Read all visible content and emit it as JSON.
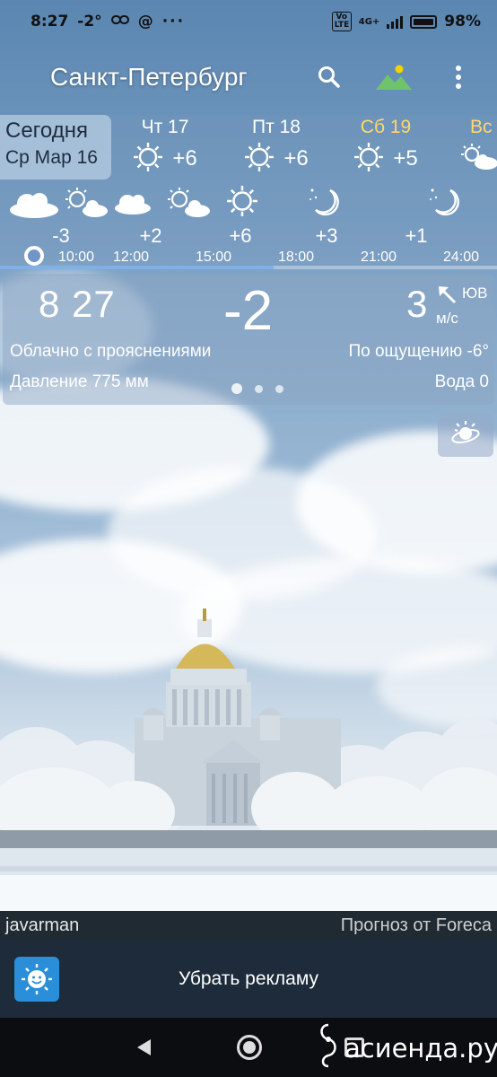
{
  "status_bar": {
    "time": "8:27",
    "temp": "-2°",
    "at_sign": "@",
    "more": "···",
    "volte": "Vo LTE",
    "network": "4G+",
    "battery": "98%"
  },
  "app_bar": {
    "city": "Санкт-Петербург",
    "icons": [
      "search-icon",
      "landscape-icon",
      "more-vert-icon"
    ]
  },
  "days": {
    "today_label": "Сегодня",
    "today_date": "Ср Мар 16",
    "items": [
      {
        "name": "Чт 17",
        "temp": "+6",
        "icon": "sun-icon",
        "color": "#ffffff"
      },
      {
        "name": "Пт 18",
        "temp": "+6",
        "icon": "sun-icon",
        "color": "#ffffff"
      },
      {
        "name": "Сб 19",
        "temp": "+5",
        "icon": "sun-icon",
        "color": "#ffd76a"
      },
      {
        "name": "Вс",
        "temp": "",
        "icon": "sun-cloud-icon",
        "color": "#ffd76a"
      }
    ]
  },
  "hours": {
    "times": [
      "10:00",
      "12:00",
      "15:00",
      "18:00",
      "21:00",
      "24:00"
    ],
    "temps": [
      "-3",
      "+2",
      "+6",
      "+3",
      "+1"
    ],
    "icons": [
      "cloud-icon",
      "sun-cloud-icon",
      "cloud-icon",
      "sun-cloud-icon",
      "sun-icon",
      "moon-icon",
      "moon-icon"
    ],
    "progress_fraction": 0.55
  },
  "current": {
    "time": "8 27",
    "temp": "-2",
    "wind_speed": "3",
    "wind_dir": "ЮВ",
    "wind_unit": "м/с",
    "description": "Облачно с прояснениями",
    "feels_like": "По ощущению -6°",
    "pressure": "Давление 775 мм",
    "water": "Вода 0",
    "page_dots": 3,
    "active_dot": 0
  },
  "credits": {
    "author": "javarman",
    "source": "Прогноз от Foreca"
  },
  "ad": {
    "label": "Убрать рекламу"
  },
  "watermark": "асиенда.ру"
}
